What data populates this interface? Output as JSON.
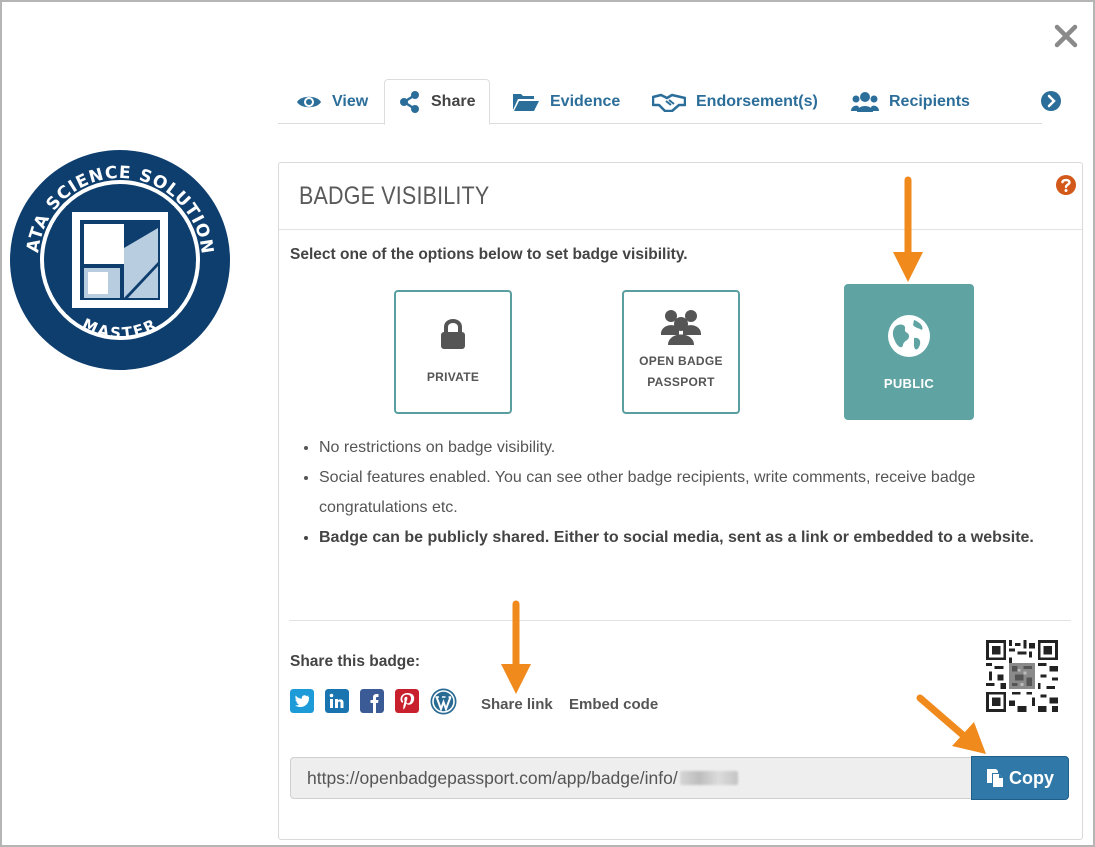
{
  "colors": {
    "accent": "#2c6e9a",
    "selected_option": "#5fa3a3",
    "copy_button": "#2f78a8",
    "annotation_arrow": "#f08a1c",
    "badge_navy": "#0e3e6e",
    "help_icon": "#d2591a"
  },
  "badge": {
    "top_text": "DATA SCIENCE SOLUTIONS",
    "bottom_text": "MASTER"
  },
  "tabs": [
    {
      "label": "View",
      "icon": "eye-icon",
      "active": false
    },
    {
      "label": "Share",
      "icon": "share-icon",
      "active": true
    },
    {
      "label": "Evidence",
      "icon": "folder-open-icon",
      "active": false
    },
    {
      "label": "Endorsement(s)",
      "icon": "handshake-icon",
      "active": false
    },
    {
      "label": "Recipients",
      "icon": "users-icon",
      "active": false
    }
  ],
  "panel": {
    "title": "BADGE VISIBILITY",
    "instruction": "Select one of the options below to set badge visibility.",
    "options": [
      {
        "label": "PRIVATE",
        "icon": "lock-icon",
        "selected": false
      },
      {
        "label_line1": "OPEN BADGE",
        "label_line2": "PASSPORT",
        "icon": "users-icon",
        "selected": false
      },
      {
        "label": "PUBLIC",
        "icon": "globe-icon",
        "selected": true
      }
    ],
    "bullets": [
      "No restrictions on badge visibility.",
      "Social features enabled. You can see other badge recipients, write comments, receive badge congratulations etc.",
      "Badge can be publicly shared. Either to social media, sent as a link or embedded to a website."
    ]
  },
  "share": {
    "title": "Share this badge:",
    "networks": [
      "twitter-icon",
      "linkedin-icon",
      "facebook-icon",
      "pinterest-icon",
      "wordpress-icon"
    ],
    "share_link_label": "Share link",
    "embed_code_label": "Embed code",
    "url": "https://openbadgepassport.com/app/badge/info/",
    "copy_label": "Copy"
  }
}
